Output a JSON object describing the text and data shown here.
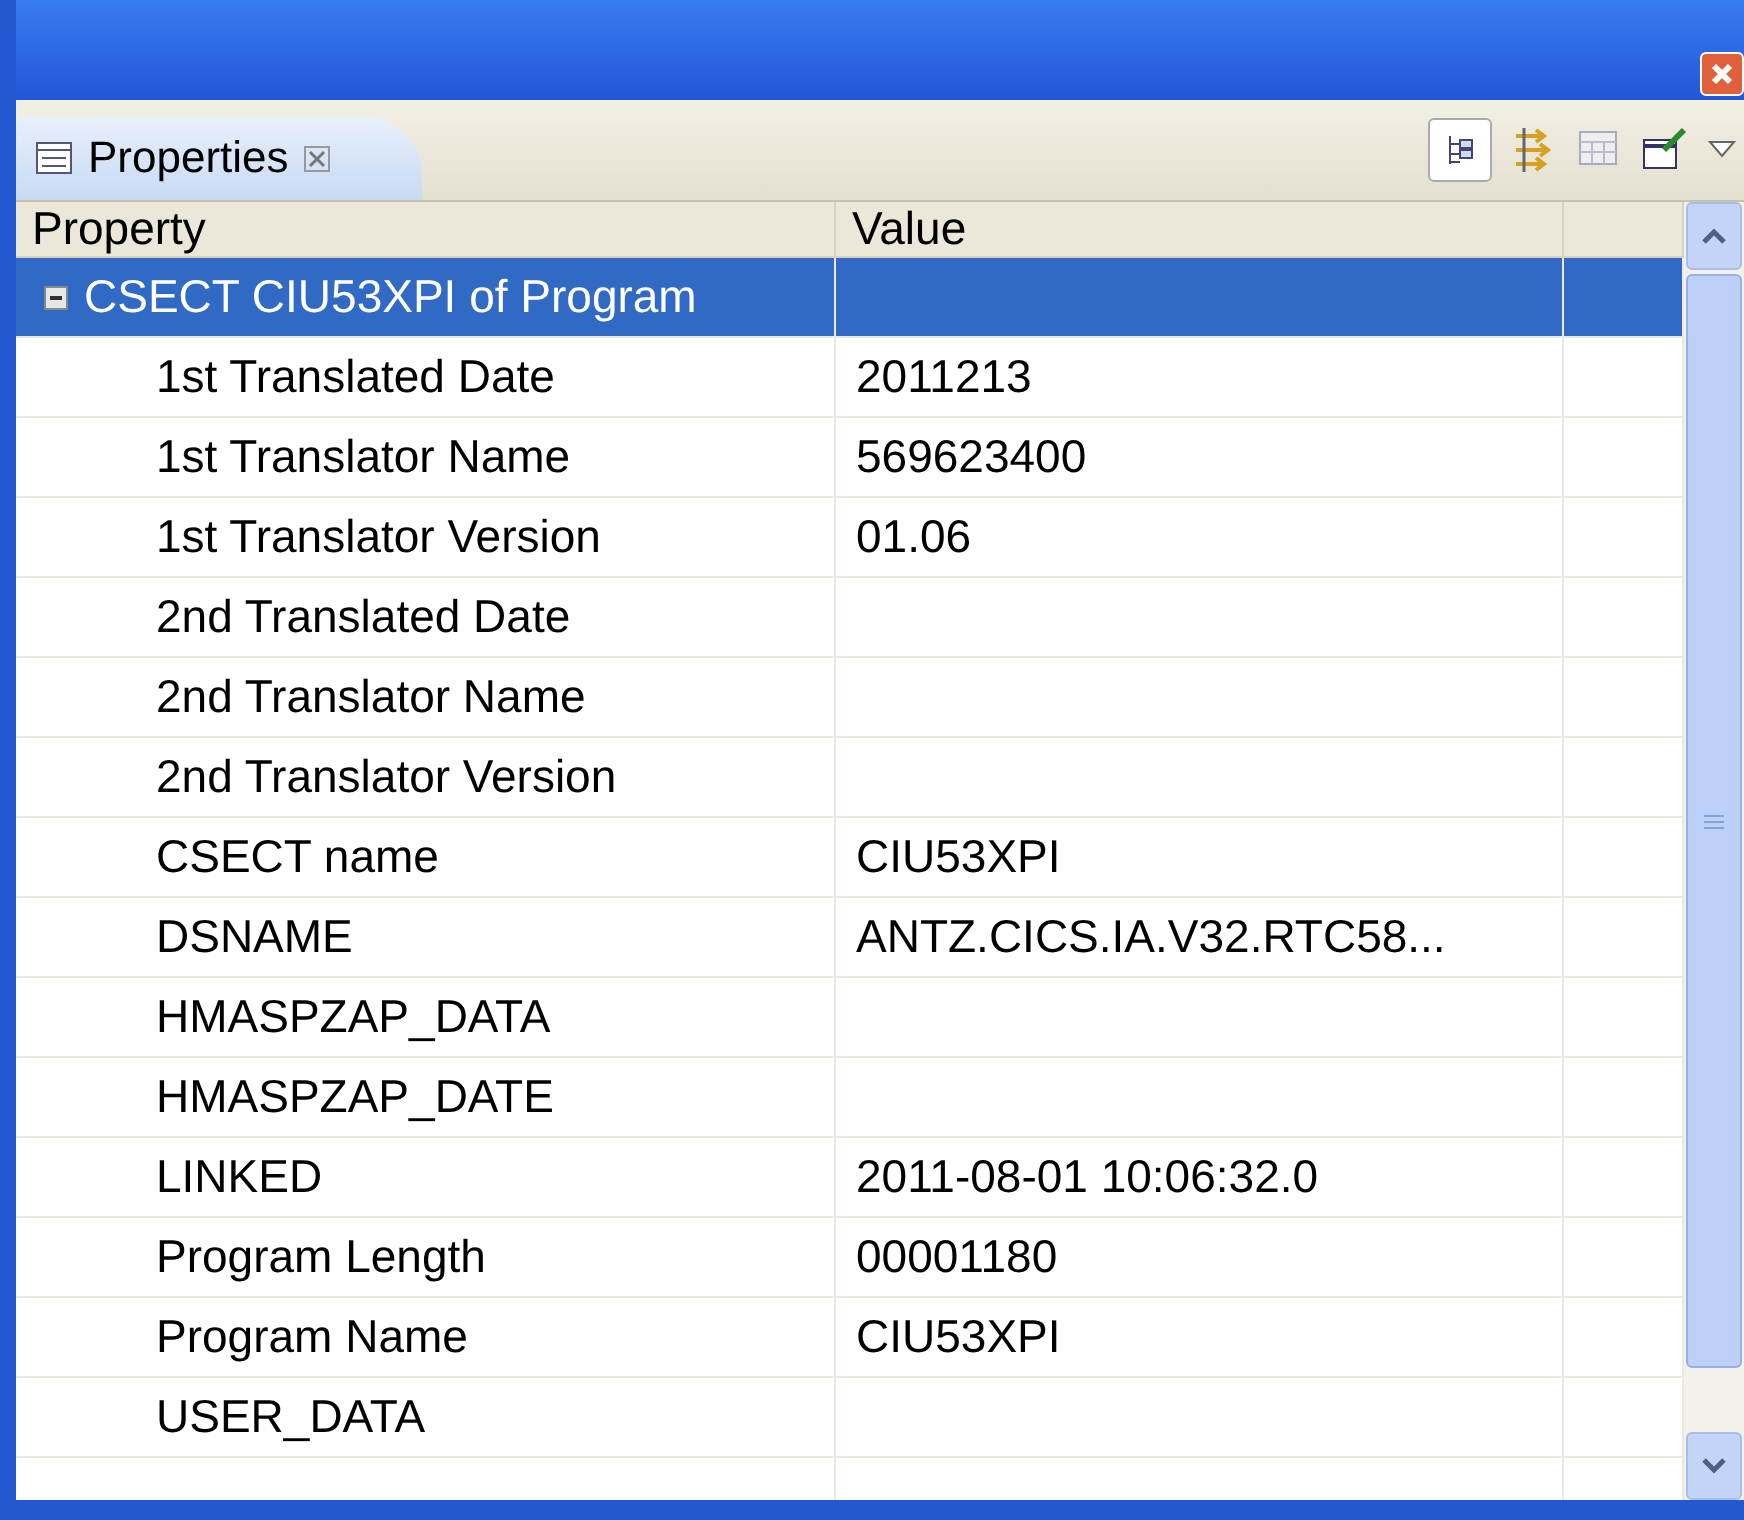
{
  "tab": {
    "label": "Properties",
    "selected": true
  },
  "columns": [
    "Property",
    "Value"
  ],
  "group": {
    "label": "CSECT CIU53XPI of Program",
    "expanded": true,
    "selected": true,
    "children": [
      {
        "property": "1st Translated Date",
        "value": "2011213"
      },
      {
        "property": "1st Translator Name",
        "value": "569623400"
      },
      {
        "property": "1st Translator Version",
        "value": "01.06"
      },
      {
        "property": "2nd Translated Date"
      },
      {
        "property": "2nd Translator Name"
      },
      {
        "property": "2nd Translator Version"
      },
      {
        "property": "CSECT name",
        "value": "CIU53XPI"
      },
      {
        "property": "DSNAME",
        "value": "ANTZ.CICS.IA.V32.RTC58..."
      },
      {
        "property": "HMASPZAP_DATA"
      },
      {
        "property": "HMASPZAP_DATE"
      },
      {
        "property": "LINKED",
        "value": "2011-08-01 10:06:32.0"
      },
      {
        "property": "Program Length",
        "value": "00001180"
      },
      {
        "property": "Program Name",
        "value": "CIU53XPI"
      },
      {
        "property": "USER_DATA"
      }
    ]
  }
}
